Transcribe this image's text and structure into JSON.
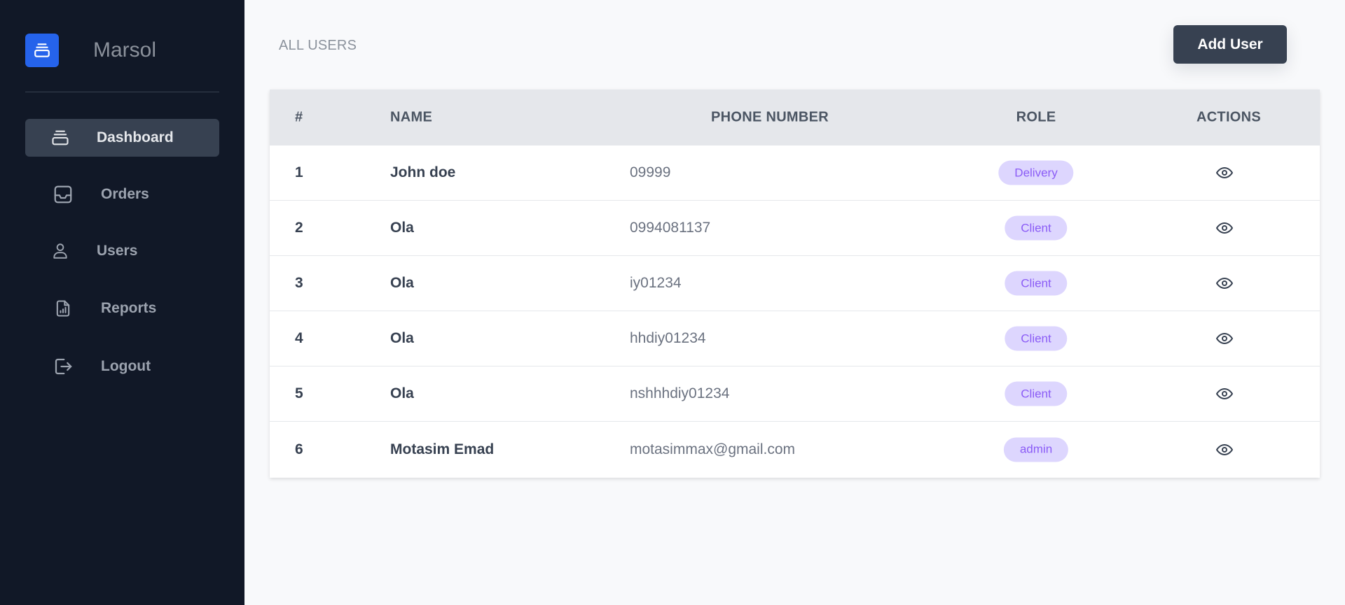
{
  "app": {
    "name": "Marsol"
  },
  "sidebar": {
    "items": [
      {
        "label": "Dashboard",
        "icon": "inbox-stack-icon",
        "active": true
      },
      {
        "label": "Orders",
        "icon": "inbox-icon",
        "active": false
      },
      {
        "label": "Users",
        "icon": "user-icon",
        "active": false
      },
      {
        "label": "Reports",
        "icon": "report-icon",
        "active": false
      },
      {
        "label": "Logout",
        "icon": "logout-icon",
        "active": false
      }
    ]
  },
  "header": {
    "title": "ALL USERS",
    "add_button_label": "Add User"
  },
  "table": {
    "columns": [
      "#",
      "NAME",
      "PHONE NUMBER",
      "ROLE",
      "ACTIONS"
    ],
    "rows": [
      {
        "num": "1",
        "name": "John doe",
        "phone": "09999",
        "role": "Delivery",
        "action_icon": "eye-icon"
      },
      {
        "num": "2",
        "name": "Ola",
        "phone": "0994081137",
        "role": "Client",
        "action_icon": "eye-icon"
      },
      {
        "num": "3",
        "name": "Ola",
        "phone": "iy01234",
        "role": "Client",
        "action_icon": "eye-icon"
      },
      {
        "num": "4",
        "name": "Ola",
        "phone": "hhdiy01234",
        "role": "Client",
        "action_icon": "eye-icon"
      },
      {
        "num": "5",
        "name": "Ola",
        "phone": "nshhhdiy01234",
        "role": "Client",
        "action_icon": "eye-icon"
      },
      {
        "num": "6",
        "name": "Motasim Emad",
        "phone": "motasimmax@gmail.com",
        "role": "admin",
        "action_icon": "eye-icon"
      }
    ]
  },
  "colors": {
    "sidebar_bg": "#111827",
    "active_item_bg": "#374151",
    "brand_accent": "#2563eb",
    "badge_bg": "#ddd6fe",
    "badge_text": "#8b5cf6",
    "table_header_bg": "#e5e7eb"
  }
}
